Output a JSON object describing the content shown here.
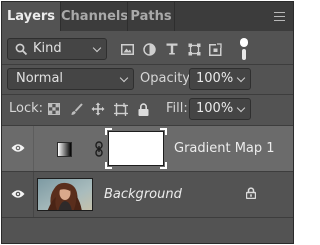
{
  "tabs": [
    {
      "label": "Layers",
      "active": true
    },
    {
      "label": "Channels",
      "active": false
    },
    {
      "label": "Paths",
      "active": false
    }
  ],
  "filter": {
    "kind_label": "Kind",
    "icons": [
      "pixel-layer-filter-icon",
      "adjustment-layer-filter-icon",
      "type-layer-filter-icon",
      "shape-layer-filter-icon",
      "smart-object-filter-icon"
    ],
    "toggle_state": "on"
  },
  "blend": {
    "mode": "Normal",
    "opacity_label": "Opacity:",
    "opacity_value": "100%"
  },
  "lock": {
    "label": "Lock:",
    "icons": [
      "lock-transparent-pixels-icon",
      "lock-image-pixels-icon",
      "lock-position-icon",
      "prevent-auto-nesting-icon",
      "lock-all-icon"
    ],
    "fill_label": "Fill:",
    "fill_value": "100%"
  },
  "layers": [
    {
      "name": "Gradient Map 1",
      "type": "adjustment",
      "selected": true,
      "visible": true
    },
    {
      "name": "Background",
      "type": "background",
      "selected": false,
      "visible": true,
      "locked": true
    }
  ],
  "colors": {
    "panel_bg": "#535353",
    "tabbar_bg": "#3c3c3c",
    "selected_row": "#6b6b6b",
    "field_bg": "#454545"
  }
}
